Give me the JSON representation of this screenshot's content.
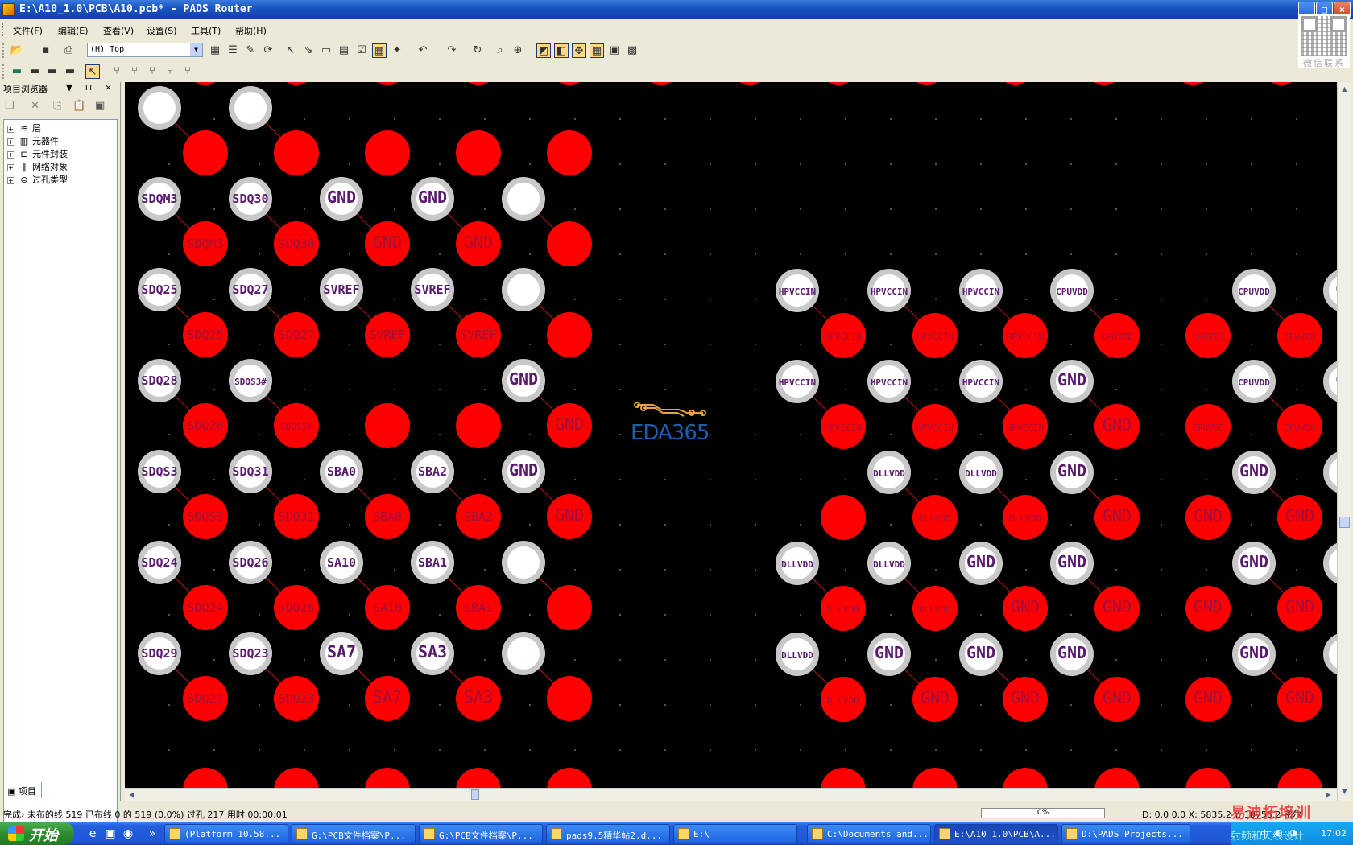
{
  "window": {
    "title": "E:\\A10_1.0\\PCB\\A10.pcb* - PADS Router",
    "controls": [
      "minimize",
      "maximize",
      "close"
    ]
  },
  "qr_label": "微信联系",
  "menu": [
    "文件(F)",
    "编辑(E)",
    "查看(V)",
    "设置(S)",
    "工具(T)",
    "帮助(H)"
  ],
  "toolbar": {
    "layer_select": "(H) Top"
  },
  "browser": {
    "title": "项目浏览器",
    "tree": [
      {
        "label": "层",
        "icon": "layers-icon"
      },
      {
        "label": "元器件",
        "icon": "component-icon"
      },
      {
        "label": "元件封装",
        "icon": "footprint-icon"
      },
      {
        "label": "网络对象",
        "icon": "net-icon"
      },
      {
        "label": "过孔类型",
        "icon": "via-icon"
      }
    ],
    "tab_label": "项目"
  },
  "pcb": {
    "logo_text": "EDA365",
    "colors": {
      "pad_red": "#ff0000",
      "pad_ring": "#c8c8c8",
      "pad_center": "#ffffff",
      "label": "#5a1a6e",
      "canvas": "#000000"
    },
    "left_white_pads": [
      [
        "",
        "",
        "",
        "",
        ""
      ],
      [
        "SDQM3",
        "SDQ30",
        "GND",
        "GND",
        ""
      ],
      [
        "SDQ25",
        "SDQ27",
        "SVREF",
        "SVREF",
        ""
      ],
      [
        "SDQ28",
        "SDQS3#",
        null,
        null,
        "GND"
      ],
      [
        "SDQS3",
        "SDQ31",
        "SBA0",
        "SBA2",
        "GND"
      ],
      [
        "SDQ24",
        "SDQ26",
        "SA10",
        "SBA1",
        ""
      ],
      [
        "SDQ29",
        "SDQ23",
        "SA7",
        "SA3",
        ""
      ]
    ],
    "left_red_pads": [
      [
        "",
        "",
        "",
        "",
        ""
      ],
      [
        "SDQM3",
        "SDQ30",
        "GND",
        "GND",
        ""
      ],
      [
        "SDQ25",
        "SDQ27",
        "SVREF",
        "SVREF",
        ""
      ],
      [
        "SDQ28",
        "SDQS3#",
        "",
        "",
        "GND"
      ],
      [
        "SDQS3",
        "SDQ31",
        "SBA0",
        "SBA2",
        "GND"
      ],
      [
        "SDQ24",
        "SDQ26",
        "SA10",
        "SBA1",
        ""
      ],
      [
        "SDQ29",
        "SDQ23",
        "SA7",
        "SA3",
        ""
      ]
    ],
    "right_white_pads": [
      [
        "HPVCCIN",
        "HPVCCIN",
        "HPVCCIN",
        "CPUVDD",
        null,
        "CPUVDD",
        "CU"
      ],
      [
        "HPVCCIN",
        "HPVCCIN",
        "HPVCCIN",
        "GND",
        null,
        "CPUVDD",
        "CU"
      ],
      [
        null,
        "DLLVDD",
        "DLLVDD",
        "GND",
        null,
        "GND",
        "G"
      ],
      [
        "DLLVDD",
        "DLLVDD",
        "GND",
        "GND",
        null,
        "GND",
        "G"
      ],
      [
        "DLLVDD",
        "GND",
        "GND",
        "GND",
        null,
        "GND",
        "G"
      ]
    ],
    "right_red_pads": [
      [
        "HPVCCIN",
        "HPVCCIN",
        "HPVCCIN",
        "CPUVDD",
        "CPUVDD",
        "CPUVDD"
      ],
      [
        "HPVCCIN",
        "HPVCCIN",
        "HPVCCIN",
        "GND",
        "CPUVDD",
        "CPUVDD"
      ],
      [
        "",
        "DLLVDD",
        "DLLVDD",
        "GND",
        "GND",
        "GND"
      ],
      [
        "DLLVDD",
        "DLLVDD",
        "GND",
        "GND",
        "GND",
        "GND"
      ],
      [
        "DLLVDD",
        "GND",
        "GND",
        "GND",
        "GND",
        "GND"
      ]
    ]
  },
  "status": {
    "left": "完成› 未布的线 519  已布线 0 的 519 (0.0%)  过孔 217  用时 00:00:01",
    "progress": "0%",
    "coords": "D: 0.0 0.0 X: 5835.2  Y: 10756.2 密尔"
  },
  "taskbar": {
    "start": "开始",
    "tasks": [
      "(Platform 10.58...",
      "G:\\PCB文件档案\\P...",
      "G:\\PCB文件档案\\P...",
      "pads9.5精华帖2.d...",
      "E:\\",
      "C:\\Documents and...",
      "E:\\A10_1.0\\PCB\\A...",
      "D:\\PADS Projects..."
    ],
    "clock": "17:02"
  },
  "watermark": "易迪拓培训",
  "watermark2": "射频和天线设计"
}
